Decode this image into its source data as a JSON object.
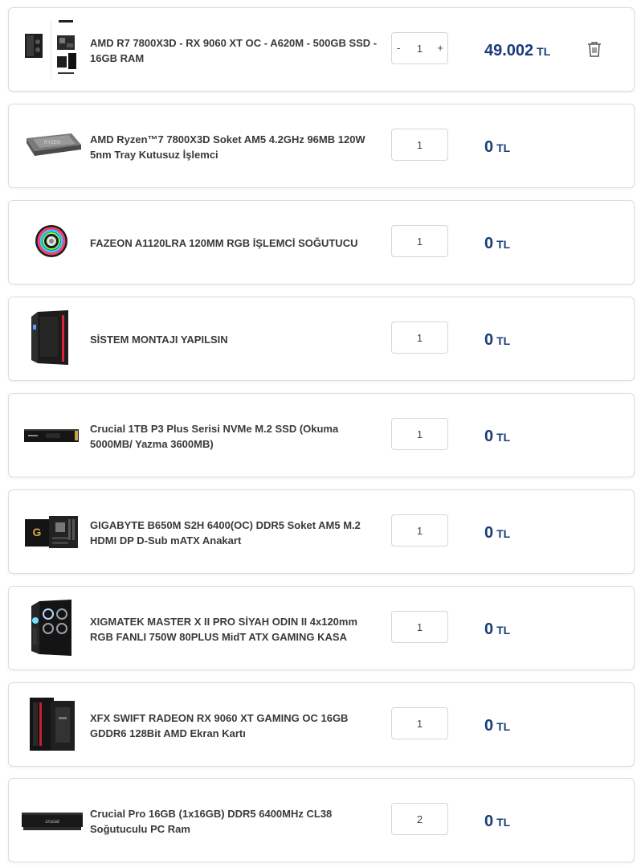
{
  "cart": {
    "currency": "TL",
    "items": [
      {
        "name": "AMD R7 7800X3D - RX 9060 XT OC - A620M - 500GB SSD - 16GB RAM",
        "qty": "1",
        "minus": "-",
        "plus": "+",
        "price": "49.002",
        "currency": "TL",
        "image": "pc-bundle-image",
        "delete_icon": "trash-icon"
      },
      {
        "name": "AMD Ryzen™7 7800X3D Soket AM5 4.2GHz 96MB 120W 5nm Tray Kutusuz İşlemci",
        "qty": "1",
        "price": "0",
        "currency": "TL",
        "image": "cpu-image"
      },
      {
        "name": "FAZEON A1120LRA 120MM RGB İŞLEMCİ SOĞUTUCU",
        "qty": "1",
        "price": "0",
        "currency": "TL",
        "image": "cpu-cooler-image"
      },
      {
        "name": "SİSTEM MONTAJI YAPILSIN",
        "qty": "1",
        "price": "0",
        "currency": "TL",
        "image": "pc-case-image"
      },
      {
        "name": "Crucial 1TB P3 Plus Serisi NVMe M.2 SSD (Okuma 5000MB/ Yazma 3600MB)",
        "qty": "1",
        "price": "0",
        "currency": "TL",
        "image": "ssd-image"
      },
      {
        "name": "GIGABYTE B650M S2H 6400(OC) DDR5 Soket AM5 M.2 HDMI DP D-Sub mATX Anakart",
        "qty": "1",
        "price": "0",
        "currency": "TL",
        "image": "motherboard-image"
      },
      {
        "name": "XIGMATEK MASTER X II PRO SİYAH ODIN II 4x120mm RGB FANLI 750W 80PLUS MidT ATX GAMING KASA",
        "qty": "1",
        "price": "0",
        "currency": "TL",
        "image": "gaming-case-image"
      },
      {
        "name": "XFX SWIFT RADEON RX 9060 XT GAMING OC 16GB GDDR6 128Bit AMD Ekran Kartı",
        "qty": "1",
        "price": "0",
        "currency": "TL",
        "image": "graphics-card-image"
      },
      {
        "name": "Crucial Pro 16GB (1x16GB) DDR5 6400MHz CL38 Soğutuculu PC Ram",
        "qty": "2",
        "price": "0",
        "currency": "TL",
        "image": "ram-image"
      }
    ]
  },
  "colors": {
    "price": "#1a3c7a",
    "text": "#3a3a3a",
    "border": "#dcdcdc"
  }
}
